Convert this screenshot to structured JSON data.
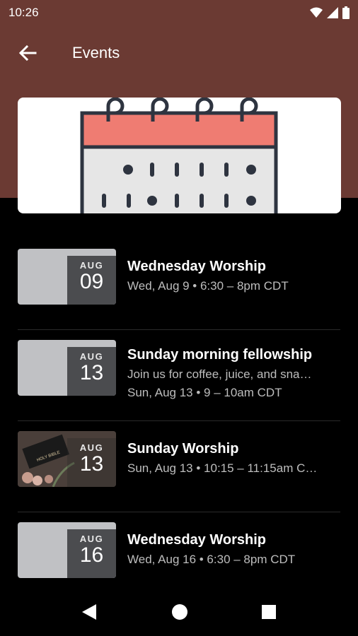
{
  "status": {
    "time": "10:26"
  },
  "header": {
    "title": "Events"
  },
  "events": [
    {
      "month": "AUG",
      "day": "09",
      "title": "Wednesday Worship",
      "description": "",
      "when": "Wed, Aug 9 • 6:30 – 8pm CDT"
    },
    {
      "month": "AUG",
      "day": "13",
      "title": "Sunday morning fellowship",
      "description": "Join us for coffee, juice, and sna…",
      "when": "Sun, Aug 13 • 9 – 10am CDT"
    },
    {
      "month": "AUG",
      "day": "13",
      "title": "Sunday Worship",
      "description": "",
      "when": "Sun, Aug 13 • 10:15 – 11:15am C…",
      "thumb_caption": "HOLY BIBLE"
    },
    {
      "month": "AUG",
      "day": "16",
      "title": "Wednesday Worship",
      "description": "",
      "when": "Wed, Aug 16 • 6:30 – 8pm CDT"
    }
  ],
  "colors": {
    "header_bg": "#6b3a33",
    "calendar_top": "#ef7c72"
  },
  "icons": [
    "wifi-icon",
    "signal-icon",
    "battery-icon",
    "back-arrow-icon",
    "calendar-illustration",
    "back-nav-icon",
    "home-nav-icon",
    "recents-nav-icon"
  ]
}
